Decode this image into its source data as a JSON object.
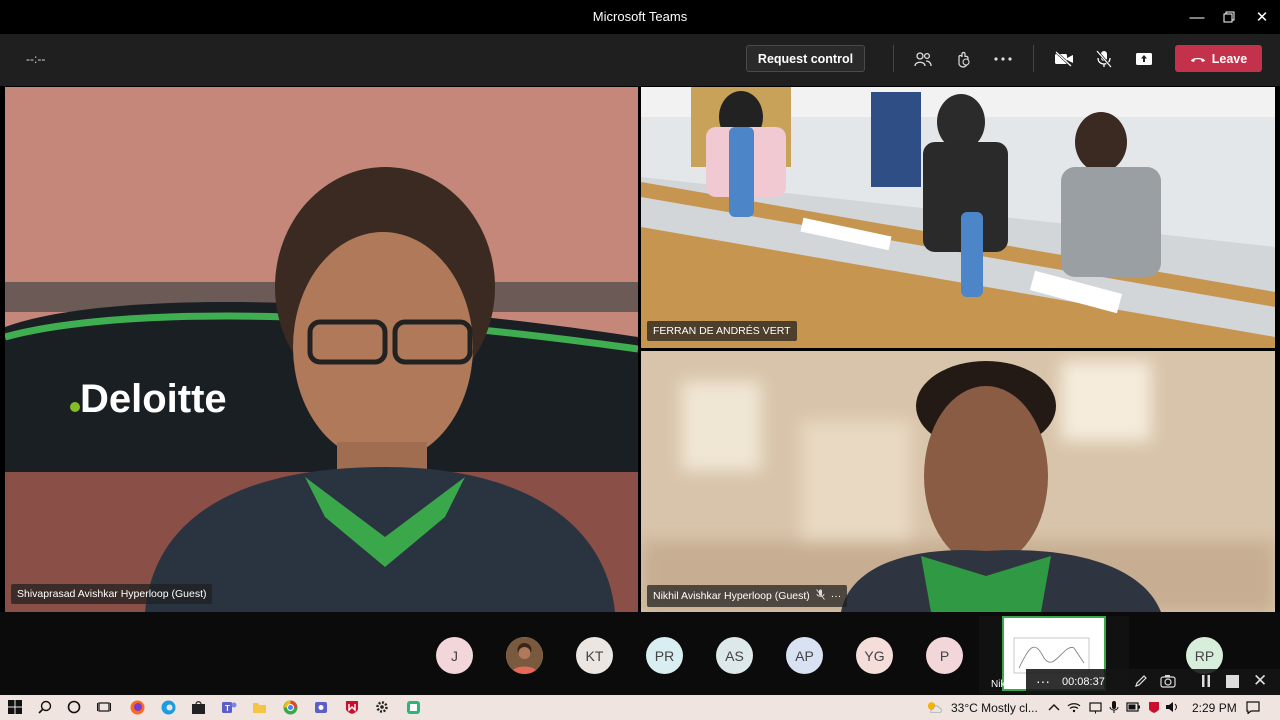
{
  "window": {
    "title": "Microsoft Teams"
  },
  "toolbar": {
    "timer": "--:--",
    "request_control_label": "Request control",
    "leave_label": "Leave"
  },
  "participants_video": [
    {
      "name": "Shivaprasad Avishkar Hyperloop (Guest)"
    },
    {
      "name": "FERRAN DE ANDRÉS VERT"
    },
    {
      "name": "Nikhil Avishkar Hyperloop (Guest)"
    }
  ],
  "roster": [
    {
      "initials": "J",
      "color": "#f2d6d9"
    },
    {
      "initials": "",
      "color": "#d9b8a0"
    },
    {
      "initials": "KT",
      "color": "#ece6e2"
    },
    {
      "initials": "PR",
      "color": "#d9eef0"
    },
    {
      "initials": "AS",
      "color": "#dde8ea"
    },
    {
      "initials": "AP",
      "color": "#d9e2f2"
    },
    {
      "initials": "YG",
      "color": "#f5ddd9"
    },
    {
      "initials": "P",
      "color": "#f2d6d9"
    },
    {
      "initials": "RP",
      "color": "#d8eedc"
    }
  ],
  "mini_panel": {
    "name": "Nikhil",
    "timer": "00:08:37"
  },
  "taskbar": {
    "weather": "33°C  Mostly cl...",
    "time": "2:29 PM"
  },
  "colors": {
    "leave": "#c4314b",
    "accent": "#6264a7"
  }
}
